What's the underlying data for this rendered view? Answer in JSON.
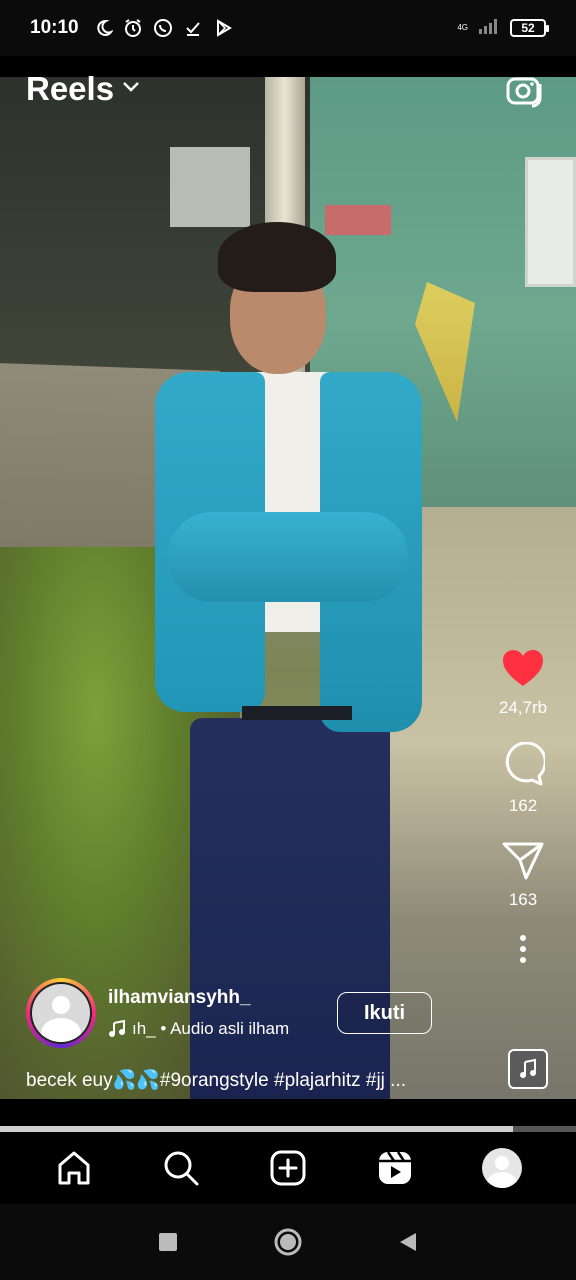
{
  "status_bar": {
    "time": "10:10",
    "network": "4G",
    "battery": "52"
  },
  "header": {
    "title": "Reels"
  },
  "actions": {
    "likes": "24,7rb",
    "comments": "162",
    "shares": "163"
  },
  "post": {
    "username": "ilhamviansyhh_",
    "audio": "ıh_ • Audio asli   ilham",
    "follow_label": "Ikuti",
    "caption": "becek euy💦💦#9orangstyle #plajarhitz #jj ..."
  },
  "playback": {
    "progress": 0.89
  },
  "icons": {
    "like": "heart-icon",
    "comment": "comment-icon",
    "share": "share-icon",
    "more": "more-icon",
    "audio": "music-note-icon",
    "camera": "camera-icon",
    "home": "home-icon",
    "search": "search-icon",
    "create": "plus-square-icon",
    "reels": "reels-icon",
    "profile": "profile-avatar"
  },
  "colors": {
    "like": "#ff3040",
    "background": "#000000"
  }
}
